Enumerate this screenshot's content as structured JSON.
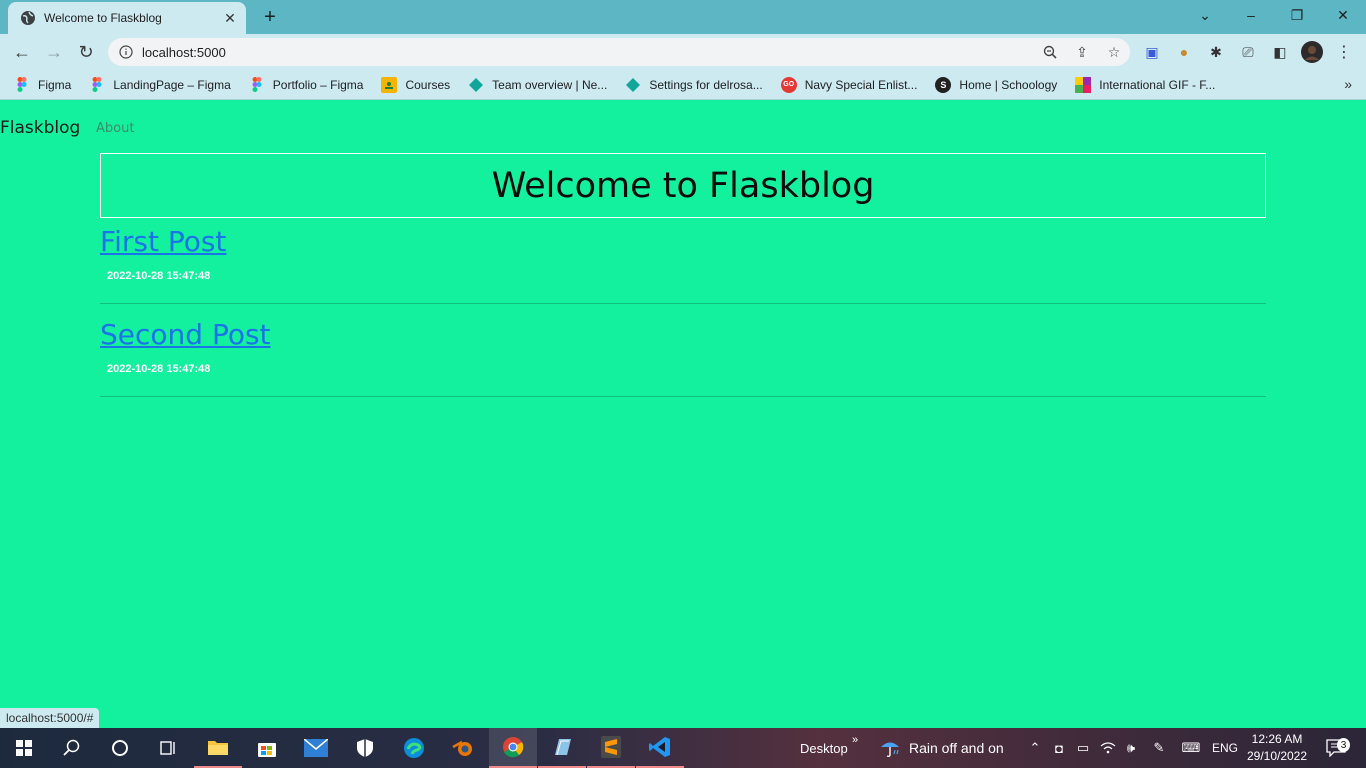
{
  "browser": {
    "tab_title": "Welcome to Flaskblog",
    "url": "localhost:5000",
    "bookmarks": [
      {
        "label": "Figma",
        "icon": "figma-icon"
      },
      {
        "label": "LandingPage – Figma",
        "icon": "figma-icon"
      },
      {
        "label": "Portfolio – Figma",
        "icon": "figma-icon"
      },
      {
        "label": "Courses",
        "icon": "classroom-icon"
      },
      {
        "label": "Team overview | Ne...",
        "icon": "diamond-icon"
      },
      {
        "label": "Settings for delrosa...",
        "icon": "diamond-icon"
      },
      {
        "label": "Navy Special Enlist...",
        "icon": "go-icon"
      },
      {
        "label": "Home | Schoology",
        "icon": "schoology-icon"
      },
      {
        "label": "International GIF - F...",
        "icon": "gif-icon"
      }
    ],
    "status_url": "localhost:5000/#"
  },
  "site": {
    "brand": "Flaskblog",
    "nav_about": "About",
    "heading": "Welcome to Flaskblog",
    "posts": [
      {
        "title": "First Post",
        "date": "2022-10-28 15:47:48"
      },
      {
        "title": "Second Post",
        "date": "2022-10-28 15:47:48"
      }
    ]
  },
  "taskbar": {
    "desktop_label": "Desktop",
    "weather": "Rain off and on",
    "language": "ENG",
    "time": "12:26 AM",
    "date": "29/10/2022",
    "notifications": "3"
  },
  "colors": {
    "page_bg": "#14f19e",
    "link": "#1a73e8",
    "tabstrip": "#5cb6c4",
    "toolbar": "#cdeaf0"
  }
}
